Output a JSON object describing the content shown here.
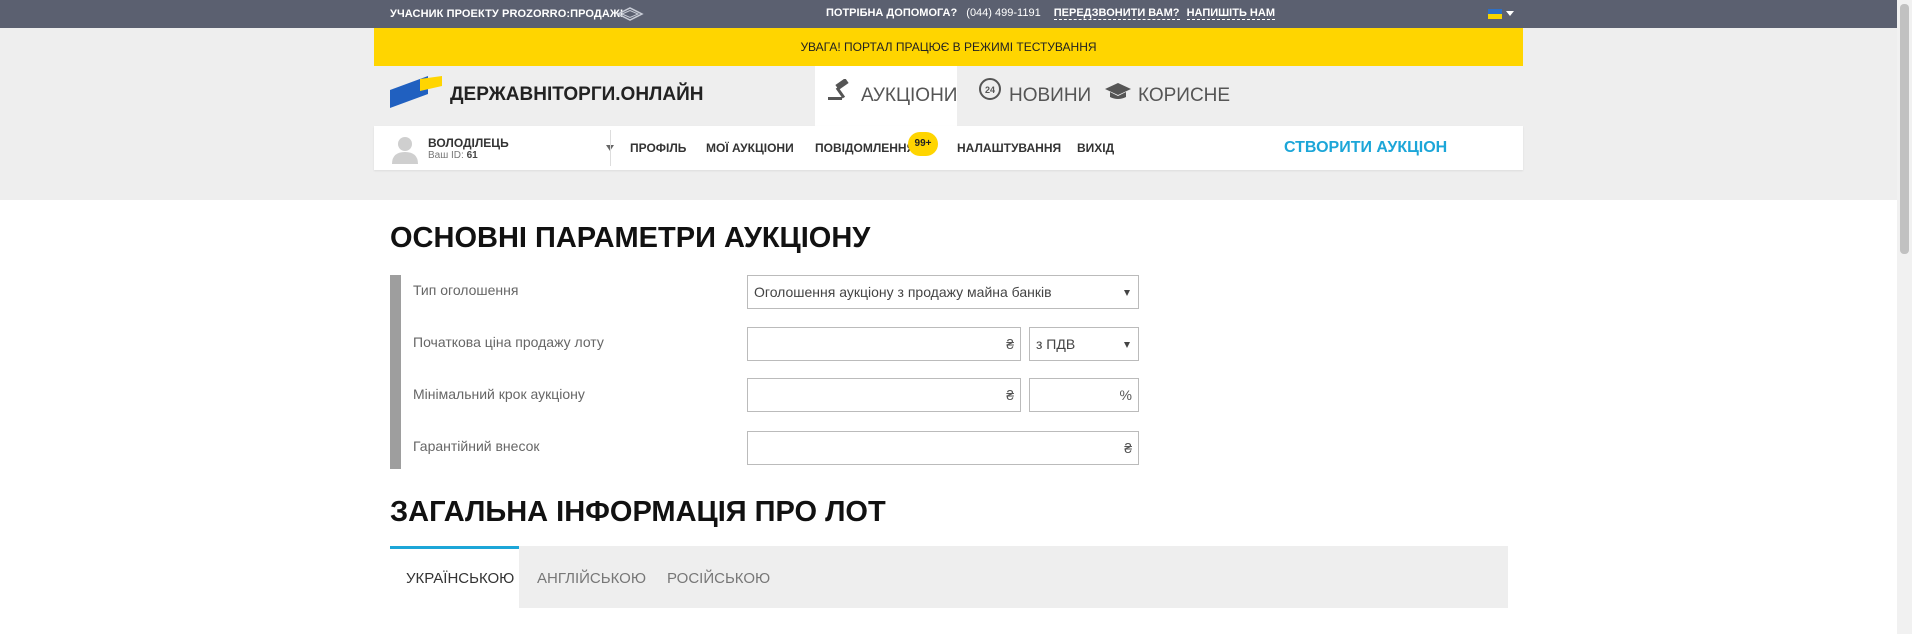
{
  "topbar": {
    "member_text": "УЧАСНИК ПРОЕКТУ PROZORRO:ПРОДАЖІ",
    "help_text": "ПОТРІБНА ДОПОМОГА?",
    "phone": "(044) 499-1191",
    "callback_link": "ПЕРЕДЗВОНИТИ ВАМ?",
    "write_link": "НАПИШІТЬ НАМ",
    "language_flag": "ua-flag-icon"
  },
  "warning_text": "УВАГА! ПОРТАЛ ПРАЦЮЄ В РЕЖИМІ ТЕСТУВАННЯ",
  "brand": {
    "name": "ДЕРЖАВНІТОРГИ.ОНЛАЙН"
  },
  "nav": {
    "tabs": [
      {
        "label": "АУКЦІОНИ",
        "icon": "gavel-icon",
        "active": true
      },
      {
        "label": "НОВИНИ",
        "icon": "news-24-icon",
        "active": false
      },
      {
        "label": "КОРИСНЕ",
        "icon": "graduation-cap-icon",
        "active": false
      }
    ]
  },
  "user": {
    "name": "ВОЛОДІЛЕЦЬ",
    "id_label": "Ваш ID:",
    "id_value": "61"
  },
  "menu": {
    "profile": "ПРОФІЛЬ",
    "my_auctions": "МОЇ АУКЦІОНИ",
    "messages": "ПОВІДОМЛЕННЯ",
    "messages_badge": "99+",
    "settings": "НАЛАШТУВАННЯ",
    "logout": "ВИХІД",
    "create_auction": "СТВОРИТИ АУКЦІОН"
  },
  "auction_params": {
    "title": "ОСНОВНІ ПАРАМЕТРИ АУКЦІОНУ",
    "announcement_type_label": "Тип оголошення",
    "announcement_type_value": "Оголошення аукціону з продажу майна банків",
    "start_price_label": "Початкова ціна продажу лоту",
    "start_price_value": "",
    "currency_symbol": "₴",
    "vat_value": "з ПДВ",
    "min_step_label": "Мінімальний крок аукціону",
    "min_step_value": "",
    "min_step_percent_value": "",
    "percent_symbol": "%",
    "guarantee_label": "Гарантійний внесок",
    "guarantee_value": ""
  },
  "lot_info": {
    "title": "ЗАГАЛЬНА ІНФОРМАЦІЯ ПРО ЛОТ",
    "tabs": [
      {
        "label": "УКРАЇНСЬКОЮ",
        "active": true
      },
      {
        "label": "АНГЛІЙСЬКОЮ",
        "active": false
      },
      {
        "label": "РОСІЙСЬКОЮ",
        "active": false
      }
    ]
  },
  "colors": {
    "topbar": "#5b6070",
    "warning": "#ffd500",
    "accent": "#1ca6d8",
    "brand_blue": "#2060c0",
    "brand_yellow": "#ffd500"
  }
}
